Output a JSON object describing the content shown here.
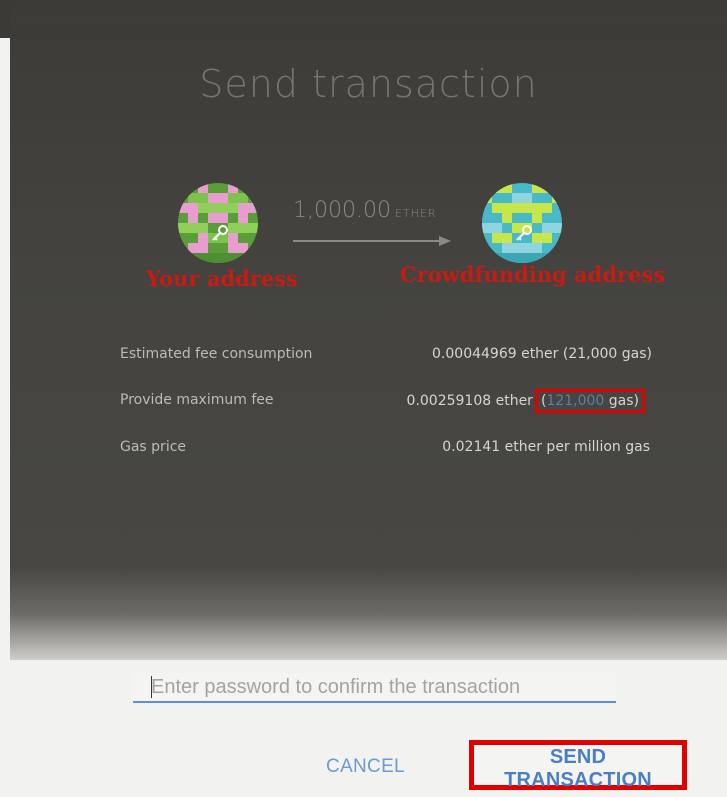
{
  "window": {
    "title": ""
  },
  "dialog": {
    "title": "Send transaction",
    "amount": {
      "value": "1,000.00",
      "unit": "ETHER"
    },
    "from_label": "Your address",
    "to_label": "Crowdfunding address",
    "rows": {
      "estimated_fee": {
        "label": "Estimated fee consumption",
        "value": "0.00044969 ether (21,000 gas)"
      },
      "max_fee": {
        "label": "Provide maximum fee",
        "value_prefix": "0.00259108 ether",
        "gas_open": "(",
        "gas_value": "121,000",
        "gas_suffix": " gas)"
      },
      "gas_price": {
        "label": "Gas price",
        "value": "0.02141 ether per million gas"
      }
    },
    "password": {
      "placeholder": "Enter password to confirm the transaction",
      "value": ""
    },
    "buttons": {
      "cancel": "CANCEL",
      "send": "SEND TRANSACTION"
    }
  },
  "colors": {
    "highlight": "#e00000",
    "accent": "#4a7fc1",
    "label_red": "#c81b14"
  },
  "icons": {
    "close": "close-icon",
    "minimize": "minimize-icon",
    "arrow": "arrow-right-icon",
    "key": "key-icon"
  }
}
